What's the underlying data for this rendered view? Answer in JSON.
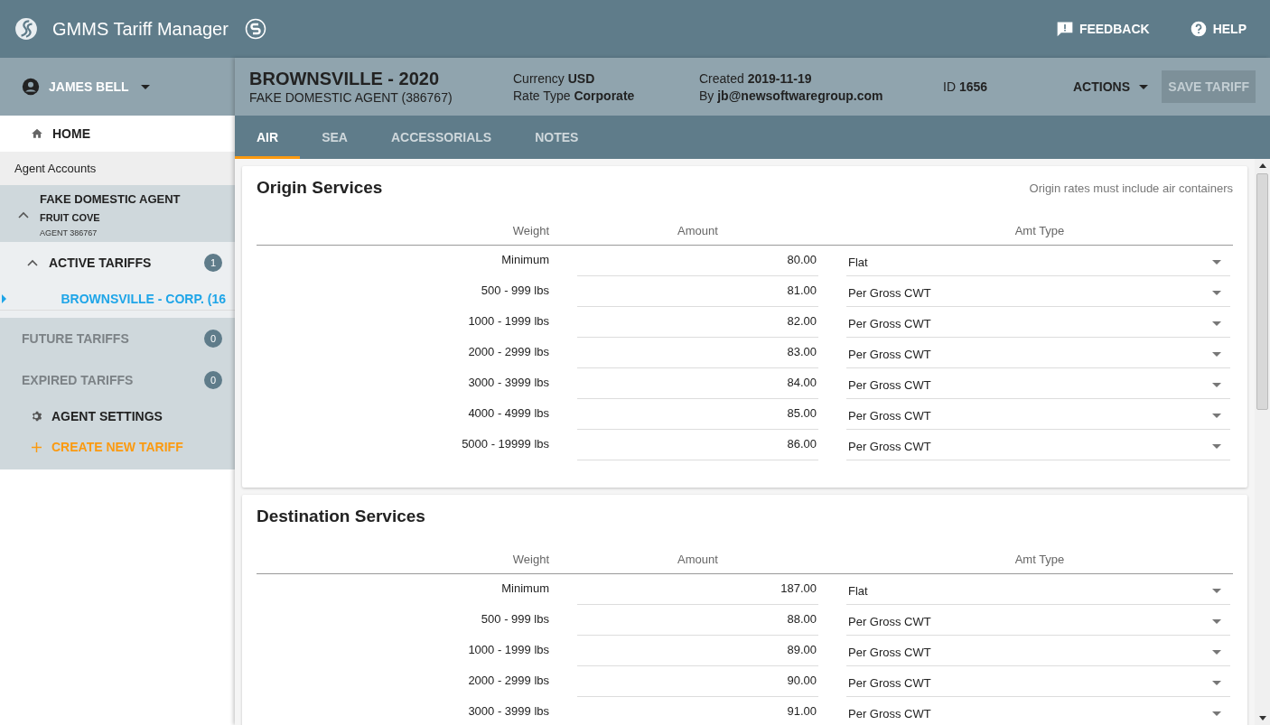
{
  "app": {
    "title": "GMMS Tariff Manager",
    "actions": [
      {
        "kind": "feedback",
        "label": "FEEDBACK"
      },
      {
        "kind": "help",
        "label": "HELP"
      }
    ]
  },
  "user": {
    "name": "JAMES BELL"
  },
  "tariff": {
    "title": "BROWNSVILLE - 2020",
    "agent": "FAKE DOMESTIC AGENT (386767)",
    "meta": [
      {
        "label": "Currency",
        "value": "USD",
        "label2": "Rate Type",
        "value2": "Corporate"
      },
      {
        "label": "Created",
        "value": "2019-11-19",
        "label2": "By",
        "value2": "jb@newsoftwaregroup.com"
      }
    ],
    "id_label": "ID",
    "id": "1656",
    "actions": "ACTIONS",
    "save": {
      "label": "SAVE TARIFF",
      "disabled": true
    }
  },
  "tabs": [
    {
      "label": "AIR",
      "selected": true
    },
    {
      "label": "SEA",
      "selected": false
    },
    {
      "label": "ACCESSORIALS",
      "selected": false
    },
    {
      "label": "NOTES",
      "selected": false
    }
  ],
  "sidebar": {
    "home": "HOME",
    "section": "Agent Accounts",
    "agent": {
      "name": "FAKE DOMESTIC AGENT",
      "city": "FRUIT COVE",
      "code": "AGENT 386767",
      "expanded": true
    },
    "groups": [
      {
        "label": "ACTIVE TARIFFS",
        "count": "1",
        "disabled": false,
        "expanded": true,
        "children": [
          {
            "label": "BROWNSVILLE - CORP. (16",
            "selected": true
          }
        ]
      },
      {
        "label": "FUTURE TARIFFS",
        "count": "0",
        "disabled": true
      },
      {
        "label": "EXPIRED TARIFFS",
        "count": "0",
        "disabled": true
      }
    ],
    "settings": "AGENT SETTINGS",
    "create": "CREATE NEW TARIFF"
  },
  "sections": [
    {
      "title": "Origin Services",
      "note": "Origin rates must include air containers",
      "columns": [
        "Weight",
        "Amount",
        "Amt Type"
      ],
      "rows": [
        {
          "weight": "Minimum",
          "amount": "80.00",
          "type": "Flat"
        },
        {
          "weight": "500 - 999 lbs",
          "amount": "81.00",
          "type": "Per Gross CWT"
        },
        {
          "weight": "1000 - 1999 lbs",
          "amount": "82.00",
          "type": "Per Gross CWT"
        },
        {
          "weight": "2000 - 2999 lbs",
          "amount": "83.00",
          "type": "Per Gross CWT"
        },
        {
          "weight": "3000 - 3999 lbs",
          "amount": "84.00",
          "type": "Per Gross CWT"
        },
        {
          "weight": "4000 - 4999 lbs",
          "amount": "85.00",
          "type": "Per Gross CWT"
        },
        {
          "weight": "5000 - 19999 lbs",
          "amount": "86.00",
          "type": "Per Gross CWT"
        }
      ]
    },
    {
      "title": "Destination Services",
      "columns": [
        "Weight",
        "Amount",
        "Amt Type"
      ],
      "rows": [
        {
          "weight": "Minimum",
          "amount": "187.00",
          "type": "Flat"
        },
        {
          "weight": "500 - 999 lbs",
          "amount": "88.00",
          "type": "Per Gross CWT"
        },
        {
          "weight": "1000 - 1999 lbs",
          "amount": "89.00",
          "type": "Per Gross CWT"
        },
        {
          "weight": "2000 - 2999 lbs",
          "amount": "90.00",
          "type": "Per Gross CWT"
        },
        {
          "weight": "3000 - 3999 lbs",
          "amount": "91.00",
          "type": "Per Gross CWT"
        }
      ]
    }
  ]
}
